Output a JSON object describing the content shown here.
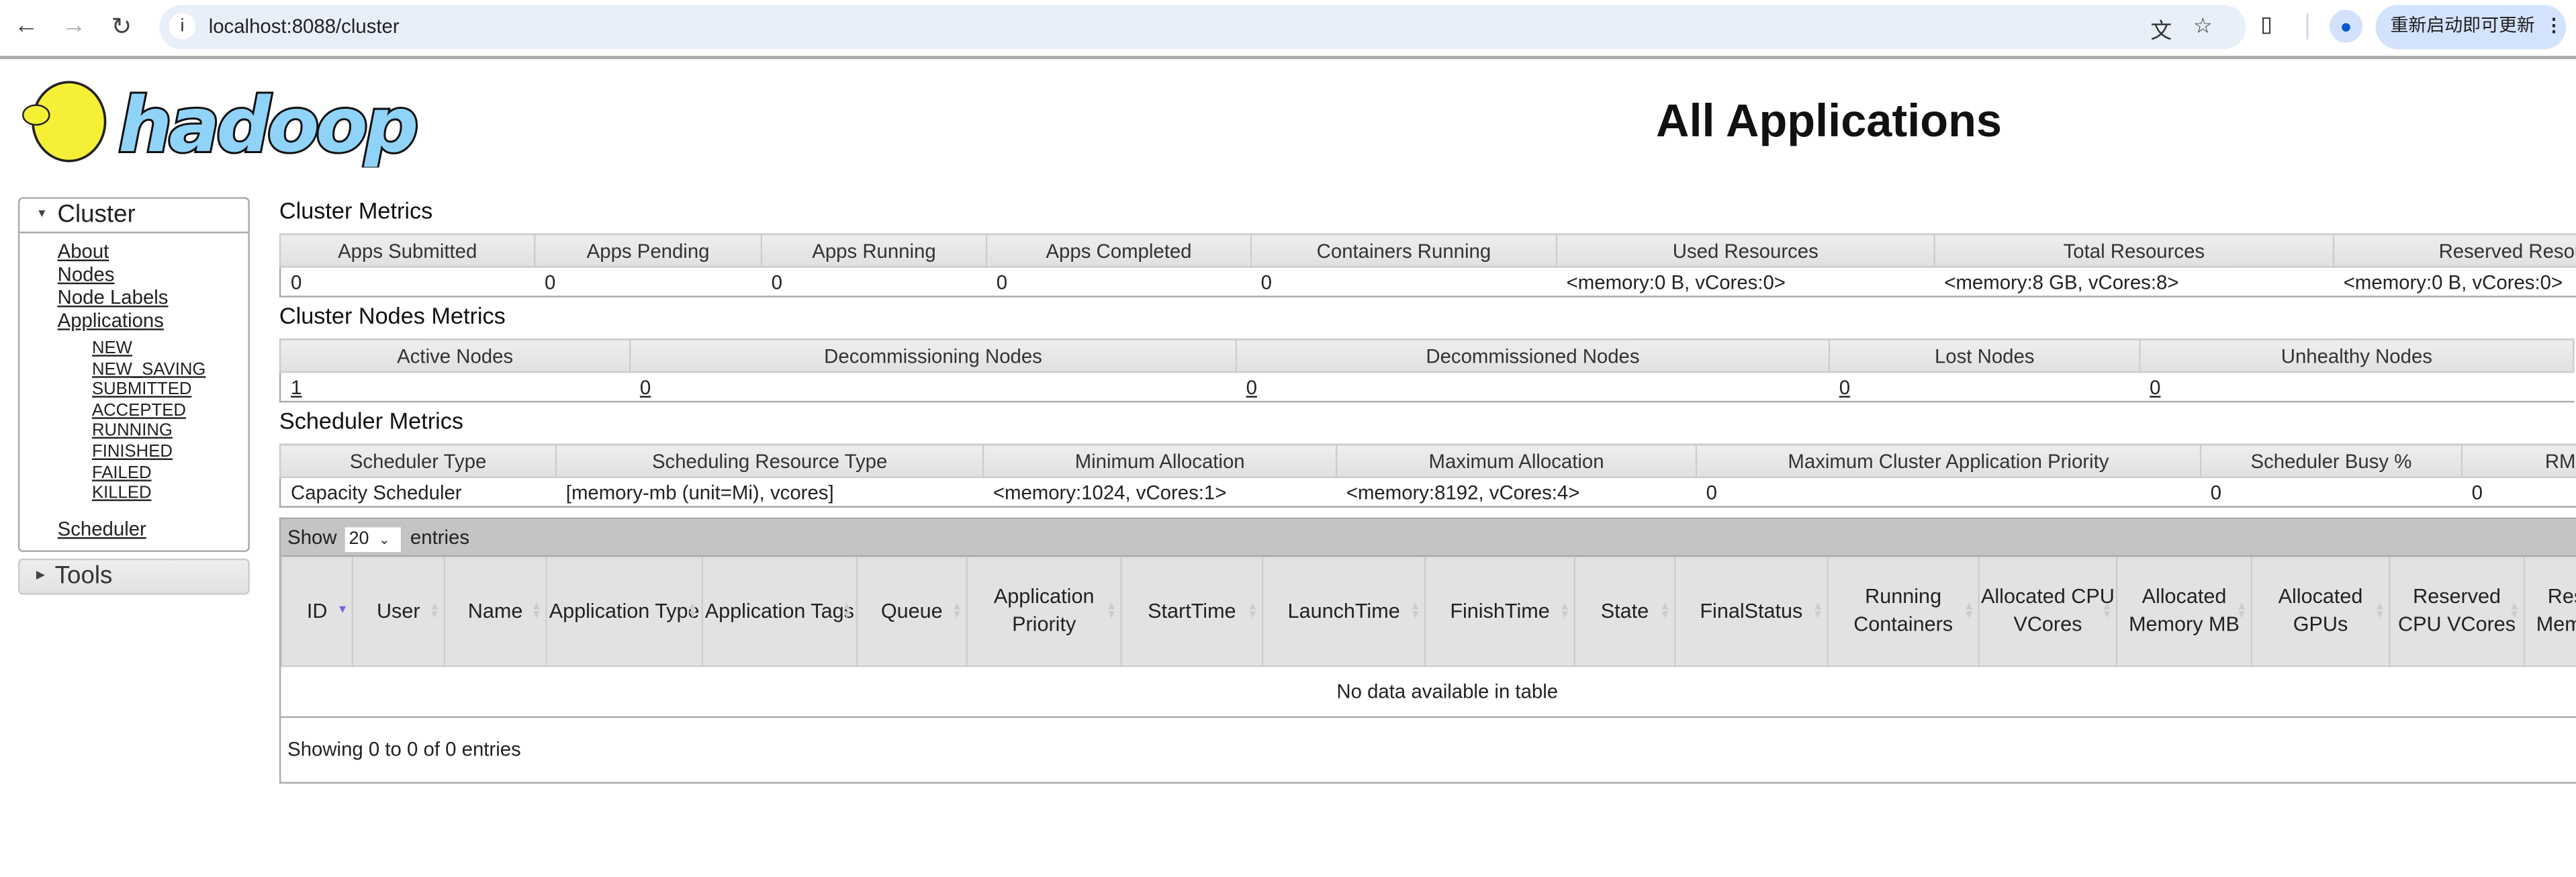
{
  "browser": {
    "url": "localhost:8088/cluster",
    "update_label": "重新启动即可更新",
    "icons": [
      "back-icon",
      "forward-icon",
      "reload-icon",
      "info-icon",
      "translate-icon",
      "star-icon",
      "extensions-icon",
      "profile-icon",
      "more-icon"
    ]
  },
  "logo": {
    "text": "hadoop"
  },
  "page_title": "All Applications",
  "sidebar": {
    "cluster_label": "Cluster",
    "links": [
      "About",
      "Nodes",
      "Node Labels",
      "Applications"
    ],
    "app_states": [
      "NEW",
      "NEW_SAVING",
      "SUBMITTED",
      "ACCEPTED",
      "RUNNING",
      "FINISHED",
      "FAILED",
      "KILLED"
    ],
    "scheduler": "Scheduler",
    "tools_label": "Tools"
  },
  "cluster_metrics": {
    "title": "Cluster Metrics",
    "headers": [
      "Apps Submitted",
      "Apps Pending",
      "Apps Running",
      "Apps Completed",
      "Containers Running",
      "Used Resources",
      "Total Resources",
      "Reserved Resources"
    ],
    "values": [
      "0",
      "0",
      "0",
      "0",
      "0",
      "<memory:0 B, vCores:0>",
      "<memory:8 GB, vCores:8>",
      "<memory:0 B, vCores:0>"
    ]
  },
  "nodes_metrics": {
    "title": "Cluster Nodes Metrics",
    "headers": [
      "Active Nodes",
      "Decommissioning Nodes",
      "Decommissioned Nodes",
      "Lost Nodes",
      "Unhealthy Nodes"
    ],
    "values": [
      "1",
      "0",
      "0",
      "0",
      "0"
    ]
  },
  "scheduler_metrics": {
    "title": "Scheduler Metrics",
    "headers": [
      "Scheduler Type",
      "Scheduling Resource Type",
      "Minimum Allocation",
      "Maximum Allocation",
      "Maximum Cluster Application Priority",
      "Scheduler Busy %",
      "RM"
    ],
    "values": [
      "Capacity Scheduler",
      "[memory-mb (unit=Mi), vcores]",
      "<memory:1024, vCores:1>",
      "<memory:8192, vCores:4>",
      "0",
      "0",
      "0"
    ]
  },
  "apps_table": {
    "show_label": "Show",
    "entries_label": "entries",
    "page_size": "20",
    "headers": [
      "ID",
      "User",
      "Name",
      "Application Type",
      "Application Tags",
      "Queue",
      "Application Priority",
      "StartTime",
      "LaunchTime",
      "FinishTime",
      "State",
      "FinalStatus",
      "Running Containers",
      "Allocated CPU VCores",
      "Allocated Memory MB",
      "Allocated GPUs",
      "Reserved CPU VCores",
      "Reserved Memory MB"
    ],
    "sorted_column": "ID",
    "empty_message": "No data available in table",
    "footer": "Showing 0 to 0 of 0 entries"
  }
}
